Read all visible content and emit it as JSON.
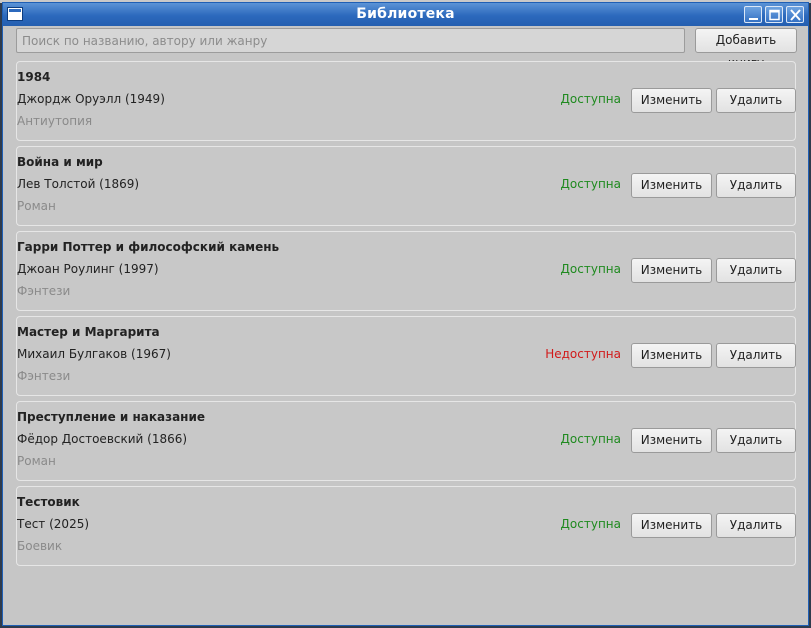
{
  "window": {
    "title": "Библиотека"
  },
  "toolbar": {
    "search_placeholder": "Поиск по названию, автору или жанру",
    "search_value": "",
    "add_label": "Добавить книгу"
  },
  "colors": {
    "available": "#1f8a1f",
    "unavailable": "#d11a1a",
    "titlebar": "#2c69bd"
  },
  "books": [
    {
      "title": "1984",
      "author": "Джордж Оруэлл (1949)",
      "genre": "Антиутопия",
      "status": "Доступна",
      "available": true,
      "edit_label": "Изменить",
      "delete_label": "Удалить"
    },
    {
      "title": "Война и мир",
      "author": "Лев Толстой (1869)",
      "genre": "Роман",
      "status": "Доступна",
      "available": true,
      "edit_label": "Изменить",
      "delete_label": "Удалить"
    },
    {
      "title": "Гарри Поттер и философский камень",
      "author": "Джоан Роулинг (1997)",
      "genre": "Фэнтези",
      "status": "Доступна",
      "available": true,
      "edit_label": "Изменить",
      "delete_label": "Удалить"
    },
    {
      "title": "Мастер и Маргарита",
      "author": "Михаил Булгаков (1967)",
      "genre": "Фэнтези",
      "status": "Недоступна",
      "available": false,
      "edit_label": "Изменить",
      "delete_label": "Удалить"
    },
    {
      "title": "Преступление и наказание",
      "author": "Фёдор Достоевский (1866)",
      "genre": "Роман",
      "status": "Доступна",
      "available": true,
      "edit_label": "Изменить",
      "delete_label": "Удалить"
    },
    {
      "title": "Тестовик",
      "author": "Тест (2025)",
      "genre": "Боевик",
      "status": "Доступна",
      "available": true,
      "edit_label": "Изменить",
      "delete_label": "Удалить"
    }
  ]
}
